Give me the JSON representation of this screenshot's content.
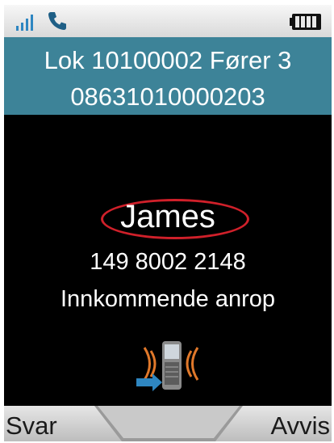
{
  "header": {
    "line1": "Lok 10100002 Fører 3",
    "line2": "08631010000203"
  },
  "status_bar": {
    "signal_icon": "signal-bars-icon",
    "call_icon": "phone-handset-icon",
    "battery_icon": "battery-full-icon"
  },
  "call": {
    "caller_name": "James",
    "caller_number": "149 8002 2148",
    "status": "Innkommende anrop",
    "status_icon": "incoming-call-ringing-icon"
  },
  "softkeys": {
    "left_label": "Svar",
    "right_label": "Avvis"
  },
  "colors": {
    "header_background": "#3d8398",
    "screen_background": "#000000",
    "highlight_ring": "#d0202a",
    "signal": "#2e86c1"
  }
}
